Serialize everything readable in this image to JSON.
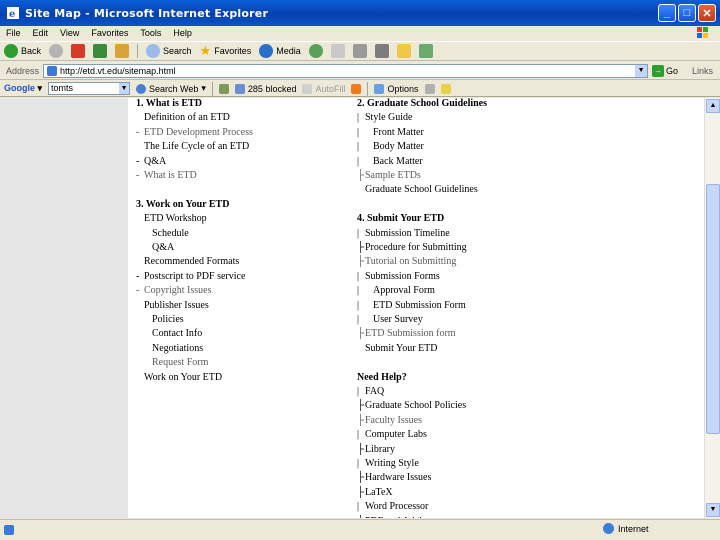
{
  "window": {
    "title": "Site Map - Microsoft Internet Explorer"
  },
  "menu": [
    "File",
    "Edit",
    "View",
    "Favorites",
    "Tools",
    "Help"
  ],
  "toolbar": {
    "back": "Back",
    "search": "Search",
    "favorites": "Favorites",
    "media": "Media"
  },
  "address": {
    "label": "Address",
    "url": "http://etd.vt.edu/sitemap.html",
    "go": "Go",
    "links": "Links"
  },
  "google": {
    "logo": "Google",
    "query": "tomts",
    "search_web": "Search Web",
    "blocked": "285 blocked",
    "autofill": "AutoFill",
    "options": "Options"
  },
  "sitemap": {
    "col1": [
      {
        "text": "1. What is ETD",
        "type": "head"
      },
      {
        "text": "Definition of an ETD",
        "type": "link"
      },
      {
        "text": "ETD Development Process",
        "type": "muted",
        "bullet": "-"
      },
      {
        "text": "The Life Cycle of an ETD",
        "type": "link"
      },
      {
        "text": "Q&A",
        "type": "link",
        "bullet": "-"
      },
      {
        "text": "What is ETD",
        "type": "muted",
        "bullet": "-"
      },
      {
        "text": "3. Work on Your ETD",
        "type": "head"
      },
      {
        "text": "ETD Workshop",
        "type": "link"
      },
      {
        "text": "Schedule",
        "type": "link",
        "indent": 1
      },
      {
        "text": "Q&A",
        "type": "link",
        "indent": 1
      },
      {
        "text": "Recommended Formats",
        "type": "link"
      },
      {
        "text": "Postscript to PDF service",
        "type": "link",
        "bullet": "-"
      },
      {
        "text": "Copyright Issues",
        "type": "muted",
        "bullet": "-"
      },
      {
        "text": "Publisher Issues",
        "type": "link"
      },
      {
        "text": "Policies",
        "type": "link",
        "indent": 1
      },
      {
        "text": "Contact Info",
        "type": "link",
        "indent": 1
      },
      {
        "text": "Negotiations",
        "type": "link",
        "indent": 1
      },
      {
        "text": "Request Form",
        "type": "muted",
        "indent": 1
      },
      {
        "text": "Work on Your ETD",
        "type": "link"
      }
    ],
    "col2": [
      {
        "text": "2. Graduate School Guidelines",
        "type": "head"
      },
      {
        "text": "Style Guide",
        "type": "link",
        "bullet": "|"
      },
      {
        "text": "Front Matter",
        "type": "link",
        "bullet": "|",
        "indent": 1
      },
      {
        "text": "Body Matter",
        "type": "link",
        "bullet": "|",
        "indent": 1
      },
      {
        "text": "Back Matter",
        "type": "link",
        "bullet": "|",
        "indent": 1
      },
      {
        "text": "Sample ETDs",
        "type": "muted",
        "bullet": "├"
      },
      {
        "text": "Graduate School Guidelines",
        "type": "link"
      },
      {
        "text": "4. Submit Your ETD",
        "type": "head"
      },
      {
        "text": "Submission Timeline",
        "type": "link",
        "bullet": "|"
      },
      {
        "text": "Procedure for Submitting",
        "type": "link",
        "bullet": "├"
      },
      {
        "text": "Tutorial on Submitting",
        "type": "muted",
        "bullet": "├"
      },
      {
        "text": "Submission Forms",
        "type": "link",
        "bullet": "|"
      },
      {
        "text": "Approval Form",
        "type": "link",
        "bullet": "|",
        "indent": 1
      },
      {
        "text": "ETD Submission Form",
        "type": "link",
        "bullet": "|",
        "indent": 1
      },
      {
        "text": "User Survey",
        "type": "link",
        "bullet": "|",
        "indent": 1
      },
      {
        "text": "ETD Submission form",
        "type": "muted",
        "bullet": "├"
      },
      {
        "text": "Submit Your ETD",
        "type": "link"
      },
      {
        "text": "Need Help?",
        "type": "head"
      },
      {
        "text": "FAQ",
        "type": "link",
        "bullet": "|"
      },
      {
        "text": "Graduate School Policies",
        "type": "link",
        "bullet": "├"
      },
      {
        "text": "Faculty Issues",
        "type": "muted",
        "bullet": "├"
      },
      {
        "text": "Computer Labs",
        "type": "link",
        "bullet": "|"
      },
      {
        "text": "Library",
        "type": "link",
        "bullet": "├"
      },
      {
        "text": "Writing Style",
        "type": "link",
        "bullet": "|"
      },
      {
        "text": "Hardware Issues",
        "type": "link",
        "bullet": "├"
      },
      {
        "text": "LaTeX",
        "type": "link",
        "bullet": "├"
      },
      {
        "text": "Word Processor",
        "type": "link",
        "bullet": "|"
      },
      {
        "text": "PDF and Adobe",
        "type": "link",
        "bullet": "├"
      }
    ]
  },
  "status": {
    "zone": "Internet"
  }
}
